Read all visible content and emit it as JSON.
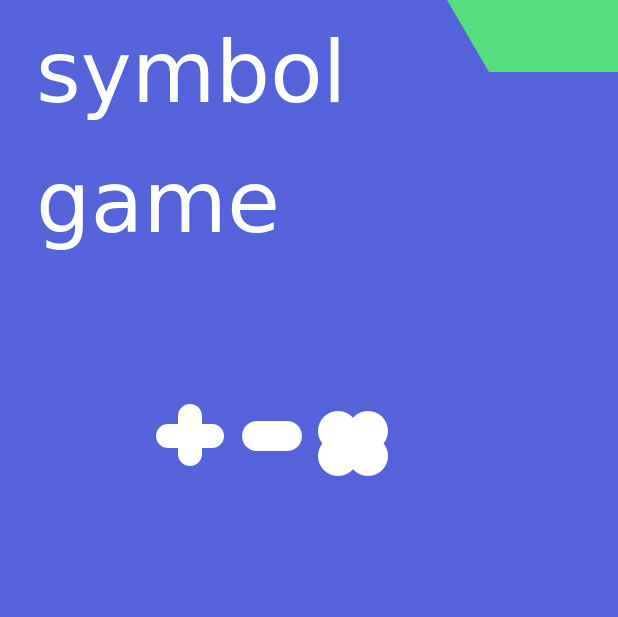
{
  "game": {
    "title_line_1": "symbol",
    "title_line_2": "game",
    "symbols": [
      "plus",
      "minus",
      "multiply"
    ]
  },
  "colors": {
    "background": "#5563DB",
    "accent": "#55DE7D",
    "text": "#FFFFFF"
  }
}
